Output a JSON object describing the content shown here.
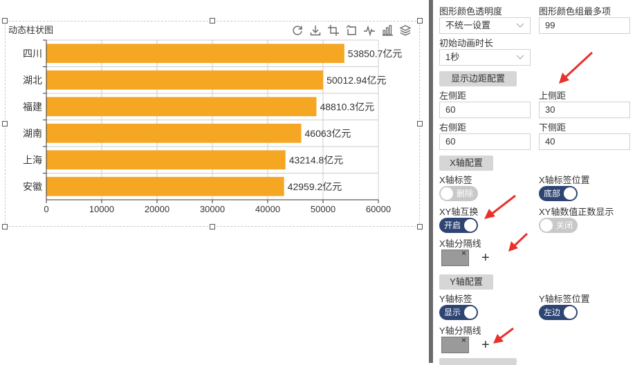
{
  "chart_title": "动态柱状图",
  "colors": {
    "bar": "#F5A623",
    "arrow": "#e8312a",
    "toggle_on": "#2e4573",
    "toggle_off": "#c8c8c8"
  },
  "toolbox": [
    "refresh-icon",
    "download-icon",
    "crop-icon",
    "restore-icon",
    "line-chart-icon",
    "bar-chart-icon",
    "stack-icon"
  ],
  "chart_data": {
    "type": "bar",
    "orientation": "horizontal",
    "categories": [
      "四川",
      "湖北",
      "福建",
      "湖南",
      "上海",
      "安徽"
    ],
    "values": [
      53850.7,
      50012.94,
      48810.3,
      46063,
      43214.8,
      42959.2
    ],
    "value_labels": [
      "53850.7亿元",
      "50012.94亿元",
      "48810.3亿元",
      "46063亿元",
      "43214.8亿元",
      "42959.2亿元"
    ],
    "xticks": [
      "0",
      "10000",
      "20000",
      "30000",
      "40000",
      "50000",
      "60000"
    ],
    "xlim": [
      0,
      60000
    ],
    "grid": true
  },
  "panel": {
    "opacity_label": "图形颜色透明度",
    "opacity_value": "不统一设置",
    "color_group_label": "图形颜色组最多项",
    "color_group_value": "99",
    "anim_label": "初始动画时长",
    "anim_value": "1秒",
    "margin_btn": "显示边距配置",
    "left_label": "左侧距",
    "left_value": "60",
    "top_label": "上侧距",
    "top_value": "30",
    "right_label": "右侧距",
    "right_value": "60",
    "bottom_label": "下侧距",
    "bottom_value": "40",
    "xaxis_btn": "X轴配置",
    "x_label_label": "X轴标签",
    "x_label_toggle": "删除",
    "x_pos_label": "X轴标签位置",
    "x_pos_toggle": "底部",
    "xy_swap_label": "XY轴互换",
    "xy_swap_toggle": "开启",
    "xy_positive_label": "XY轴数值正数显示",
    "xy_positive_toggle": "关闭",
    "x_split_label": "X轴分隔线",
    "x_split_remove": "×",
    "x_split_add": "+",
    "yaxis_btn": "Y轴配置",
    "y_label_label": "Y轴标签",
    "y_label_toggle": "显示",
    "y_pos_label": "Y轴标签位置",
    "y_pos_toggle": "左边",
    "y_split_label": "Y轴分隔线",
    "y_split_remove": "×",
    "y_split_add": "+"
  }
}
